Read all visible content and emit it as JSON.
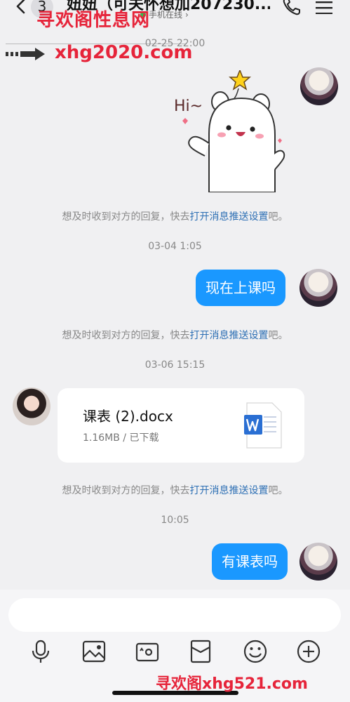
{
  "header": {
    "badge_count": "3",
    "contact_name": "妞妞（可关怀想加207230...",
    "online_status": "手机在线"
  },
  "watermarks": {
    "top": "寻欢阁性息网",
    "url": "xhg2020.com",
    "bottom": "寻欢阁xhg521.com"
  },
  "chat": {
    "timestamps": [
      "02-25 22:00",
      "03-04 1:05",
      "03-06 15:15",
      "10:05"
    ],
    "hint": {
      "text": "想及时收到对方的回复，快去",
      "link": "打开消息推送设置",
      "suffix": "吧。"
    },
    "sticker_text": "Hi~",
    "messages": [
      {
        "text": "现在上课吗"
      },
      {
        "text": "有课表吗"
      }
    ],
    "file": {
      "name": "课表 (2).docx",
      "meta": "1.16MB / 已下载",
      "icon": "word-doc-icon"
    }
  },
  "input": {
    "placeholder": ""
  },
  "toolbar": [
    "microphone-icon",
    "image-icon",
    "camera-icon",
    "red-packet-icon",
    "emoji-icon",
    "plus-icon"
  ],
  "colors": {
    "bubble": "#1a98ff",
    "link": "#2d6fb4",
    "online": "#2fc24f",
    "watermark": "#e6243a"
  }
}
